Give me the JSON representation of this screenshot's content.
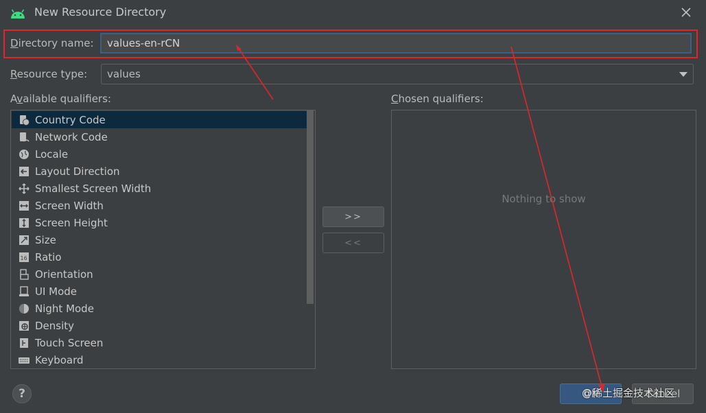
{
  "window": {
    "title": "New Resource Directory",
    "icon": "android-icon"
  },
  "form": {
    "directory_label_prefix": "D",
    "directory_label_rest": "irectory name:",
    "directory_value": "values-en-rCN",
    "resource_type_label_prefix": "R",
    "resource_type_label_rest": "esource type:",
    "resource_type_value": "values"
  },
  "available": {
    "label_prefix": "A",
    "label_mid": "v",
    "label_rest": "ailable qualifiers:",
    "items": [
      {
        "label": "Country Code",
        "icon": "country-code-icon"
      },
      {
        "label": "Network Code",
        "icon": "network-code-icon"
      },
      {
        "label": "Locale",
        "icon": "globe-icon"
      },
      {
        "label": "Layout Direction",
        "icon": "layout-direction-icon"
      },
      {
        "label": "Smallest Screen Width",
        "icon": "smallest-width-icon"
      },
      {
        "label": "Screen Width",
        "icon": "screen-width-icon"
      },
      {
        "label": "Screen Height",
        "icon": "screen-height-icon"
      },
      {
        "label": "Size",
        "icon": "size-icon"
      },
      {
        "label": "Ratio",
        "icon": "ratio-icon"
      },
      {
        "label": "Orientation",
        "icon": "orientation-icon"
      },
      {
        "label": "UI Mode",
        "icon": "ui-mode-icon"
      },
      {
        "label": "Night Mode",
        "icon": "night-mode-icon"
      },
      {
        "label": "Density",
        "icon": "density-icon"
      },
      {
        "label": "Touch Screen",
        "icon": "touch-screen-icon"
      },
      {
        "label": "Keyboard",
        "icon": "keyboard-icon"
      }
    ]
  },
  "buttons": {
    "add": ">>",
    "remove": "<<",
    "ok": "OK",
    "cancel": "Cancel",
    "help": "?"
  },
  "chosen": {
    "label_prefix": "C",
    "label_rest": "hosen qualifiers:",
    "empty_text": "Nothing to show"
  },
  "watermark": "@稀土掘金技术社区",
  "colors": {
    "accent": "#365880",
    "annotation": "#e0262a",
    "selection": "#0d293e"
  }
}
